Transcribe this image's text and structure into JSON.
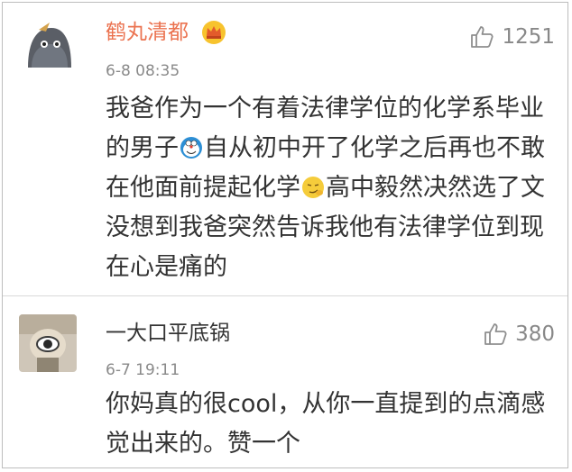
{
  "comments": [
    {
      "username": "鹤丸清都",
      "time": "6-8 08:35",
      "likes": "1251",
      "lines": [
        [
          "我爸作为一个有着法律学位的化学系毕业"
        ],
        [
          "的男子",
          "自从初中开了化学之后再也不敢"
        ],
        [
          "在他面前提起化学",
          "高中毅然决然选了文"
        ],
        [
          "没想到我爸突然告诉我他有法律学位到现"
        ],
        [
          "在心是痛的"
        ]
      ],
      "icons": {
        "badge": "crown-icon",
        "emoji1": "doraemon-emoji-icon",
        "emoji2": "smirk-emoji-icon"
      }
    },
    {
      "username": "一大口平底锅",
      "time": "6-7 19:11",
      "likes": "380",
      "lines": [
        [
          "你妈真的很cool，从你一直提到的点滴感"
        ],
        [
          "觉出来的。赞一个"
        ]
      ]
    }
  ],
  "colors": {
    "vip_name": "#eb7350",
    "text": "#333333",
    "meta": "#8a8a8a"
  }
}
